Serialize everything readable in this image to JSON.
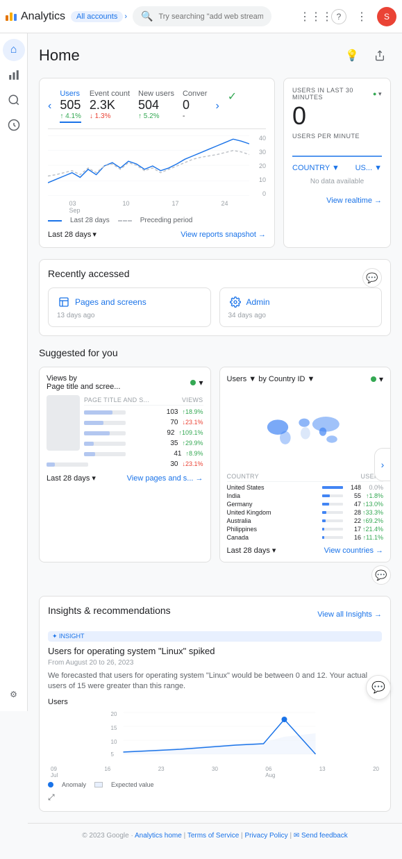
{
  "app": {
    "title": "Analytics",
    "account": "All accounts",
    "search_placeholder": "Try searching \"add web stream\""
  },
  "nav_icons": [
    "apps",
    "help",
    "more_vert"
  ],
  "avatar_initial": "S",
  "sidebar": {
    "items": [
      {
        "id": "home",
        "icon": "⌂",
        "active": true
      },
      {
        "id": "reports",
        "icon": "📊"
      },
      {
        "id": "explore",
        "icon": "🔍"
      },
      {
        "id": "advertising",
        "icon": "📢"
      },
      {
        "id": "configure",
        "icon": "⚙"
      }
    ]
  },
  "page": {
    "title": "Home"
  },
  "metrics": [
    {
      "label": "Users",
      "value": "505",
      "change": "↑ 4.1%",
      "direction": "up",
      "active": true
    },
    {
      "label": "Event count",
      "value": "2.3K",
      "change": "↓ 1.3%",
      "direction": "down",
      "active": false
    },
    {
      "label": "New users",
      "value": "504",
      "change": "↑ 5.2%",
      "direction": "up",
      "active": false
    },
    {
      "label": "Conver",
      "value": "0",
      "change": "-",
      "direction": "neutral",
      "active": false
    }
  ],
  "chart": {
    "y_labels": [
      "40",
      "30",
      "20",
      "10",
      "0"
    ],
    "x_labels": [
      "03\nSep",
      "10",
      "17",
      "24"
    ],
    "legend_current": "Last 28 days",
    "legend_preceding": "Preceding period"
  },
  "card_footer": {
    "date_range": "Last 28 days",
    "view_link": "View reports snapshot →"
  },
  "realtime": {
    "label": "USERS IN LAST 30 MINUTES",
    "count": "0",
    "sublabel": "USERS PER MINUTE",
    "filter_country": "COUNTRY ▼",
    "filter_us": "US... ▼",
    "no_data": "No data available",
    "view_link": "View realtime →"
  },
  "recently_accessed": {
    "title": "Recently accessed",
    "items": [
      {
        "name": "Pages and screens",
        "age": "13 days ago",
        "icon_color": "#1a73e8"
      },
      {
        "name": "Admin",
        "age": "34 days ago",
        "icon_color": "#5f6368"
      }
    ]
  },
  "suggested": {
    "title": "Suggested for you",
    "card1": {
      "title": "Views by Page title and scree...",
      "sub": "PAGE TITLE AND S...",
      "col2": "VIEWS",
      "rows": [
        {
          "bar_pct": 68,
          "val": "103",
          "change": "↑ 18.9%",
          "dir": "up"
        },
        {
          "bar_pct": 46,
          "val": "70",
          "change": "↓ 23.1%",
          "dir": "down"
        },
        {
          "bar_pct": 61,
          "val": "92",
          "change": "↑ 109.1%",
          "dir": "up"
        },
        {
          "bar_pct": 23,
          "val": "35",
          "change": "↑ 29.9%",
          "dir": "up"
        },
        {
          "bar_pct": 27,
          "val": "41",
          "change": "↑ 8.9%",
          "dir": "up"
        },
        {
          "bar_pct": 20,
          "val": "30",
          "change": "↓ 23.1%",
          "dir": "down"
        }
      ],
      "date_range": "Last 28 days",
      "view_link": "View pages and s... →"
    },
    "card2": {
      "title": "Users ▼ by Country ID ▼",
      "countries": [
        {
          "name": "United States",
          "bar_pct": 100,
          "val": "148",
          "change": "0.0%",
          "dir": "neutral"
        },
        {
          "name": "India",
          "bar_pct": 37,
          "val": "55",
          "change": "↑ 1.8%",
          "dir": "up"
        },
        {
          "name": "Germany",
          "bar_pct": 32,
          "val": "47",
          "change": "↑ 13.0%",
          "dir": "up"
        },
        {
          "name": "United Kingdom",
          "bar_pct": 19,
          "val": "28",
          "change": "↑ 33.3%",
          "dir": "up"
        },
        {
          "name": "Australia",
          "bar_pct": 15,
          "val": "22",
          "change": "↑ 69.2%",
          "dir": "up"
        },
        {
          "name": "Philippines",
          "bar_pct": 11,
          "val": "17",
          "change": "↑ 21.4%",
          "dir": "up"
        },
        {
          "name": "Canada",
          "bar_pct": 11,
          "val": "16",
          "change": "↑ 11.1%",
          "dir": "up"
        }
      ],
      "date_range": "Last 28 days",
      "view_link": "View countries →"
    }
  },
  "insights": {
    "title": "Insights & recommendations",
    "view_all": "View all Insights →",
    "badge": "✦ INSIGHT",
    "insight_title": "Users for operating system \"Linux\" spiked",
    "insight_date": "From August 20 to 26, 2023",
    "insight_text": "We forecasted that users for operating system \"Linux\" would be between 0 and 12. Your actual users of 15 were greater than this range.",
    "insight_sublabel": "Users",
    "chart_y_max": "20",
    "chart_x_labels": [
      "09",
      "16",
      "23",
      "30",
      "06",
      "13",
      "20"
    ],
    "chart_x_months": [
      "Jul",
      "",
      "",
      "",
      "Aug",
      "",
      ""
    ],
    "legend_anomaly": "Anomaly",
    "legend_expected": "Expected value"
  },
  "footer": {
    "text": "© 2023 Google",
    "links": [
      "Analytics home",
      "Terms of Service",
      "Privacy Policy",
      "Send feedback"
    ]
  }
}
